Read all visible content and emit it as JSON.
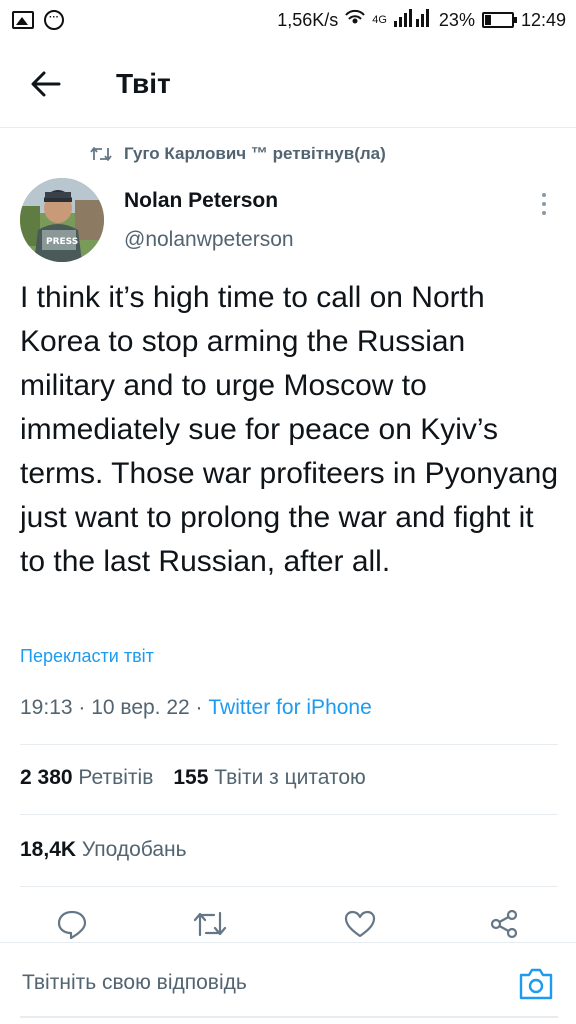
{
  "status_bar": {
    "speed": "1,56K/s",
    "network": "4G",
    "battery_percent": "23%",
    "battery_level": 0.23,
    "time": "12:49"
  },
  "header": {
    "title": "Твіт"
  },
  "retweet": {
    "text": "Гуго Карлович ™ ретвітнув(ла)"
  },
  "author": {
    "name": "Nolan Peterson",
    "handle": "@nolanwpeterson",
    "vest_text": "PRESS"
  },
  "tweet": {
    "text": "I think it’s high time to call on North Korea to stop arming the Russian military and to urge Moscow to immediately sue for peace on Kyiv’s terms. Those war profiteers in Pyonyang just want to prolong the war and fight it to the last Russian, after all.",
    "translate_label": "Перекласти твіт",
    "time": "19:13 · 10 вер. 22 · ",
    "source": "Twitter for iPhone"
  },
  "stats": {
    "retweets_count": "2 380",
    "retweets_label": "Ретвітів",
    "quotes_count": "155",
    "quotes_label": "Твіти з цитатою",
    "likes_count": "18,4K",
    "likes_label": "Уподобань"
  },
  "reply": {
    "placeholder": "Твітніть свою відповідь"
  },
  "colors": {
    "accent": "#1d9bf0",
    "secondary_text": "#536471",
    "icon": "#657786"
  },
  "icons": [
    "image-icon",
    "more-dots-icon",
    "wifi-icon",
    "signal-icon",
    "battery-icon",
    "back-arrow-icon",
    "retweet-icon",
    "more-vertical-icon",
    "reply-icon",
    "like-icon",
    "share-icon",
    "camera-icon"
  ]
}
